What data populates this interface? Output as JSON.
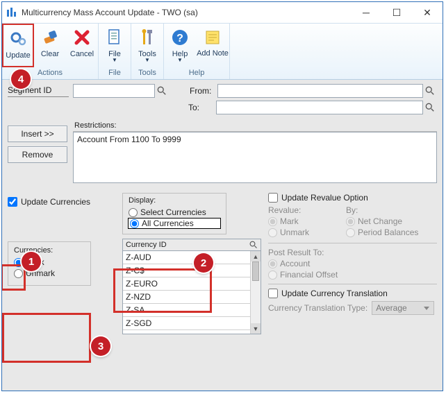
{
  "window": {
    "title": "Multicurrency Mass Account Update  -  TWO (sa)"
  },
  "ribbon": {
    "update": "Update",
    "clear": "Clear",
    "cancel": "Cancel",
    "file": "File",
    "tools": "Tools",
    "help": "Help",
    "addnote": "Add Note",
    "grp_actions": "Actions",
    "grp_file": "File",
    "grp_tools": "Tools",
    "grp_help": "Help"
  },
  "fields": {
    "segment_label": "Segment ID",
    "from_label": "From:",
    "to_label": "To:",
    "restrictions_label": "Restrictions:",
    "insert_btn": "Insert >>",
    "remove_btn": "Remove",
    "restriction_item": "Account From 1100 To 9999"
  },
  "update_curr": {
    "checkbox": "Update Currencies",
    "display_label": "Display:",
    "opt_select": "Select Currencies",
    "opt_all": "All Currencies",
    "currencies_label": "Currencies:",
    "opt_mark": "Mark",
    "opt_unmark": "Unmark",
    "hdr_currency": "Currency ID",
    "list": [
      "Z-AUD",
      "Z-C$",
      "Z-EURO",
      "Z-NZD",
      "Z-SA",
      "Z-SGD"
    ]
  },
  "revalue": {
    "chk": "Update Revalue Option",
    "revalue_lbl": "Revalue:",
    "by_lbl": "By:",
    "mark": "Mark",
    "unmark": "Unmark",
    "net": "Net Change",
    "period": "Period Balances",
    "post_lbl": "Post Result To:",
    "account": "Account",
    "fin": "Financial Offset",
    "chk_trans": "Update Currency Translation",
    "trans_lbl": "Currency Translation Type:",
    "trans_val": "Average"
  },
  "markers": {
    "m1": "1",
    "m2": "2",
    "m3": "3",
    "m4": "4"
  }
}
